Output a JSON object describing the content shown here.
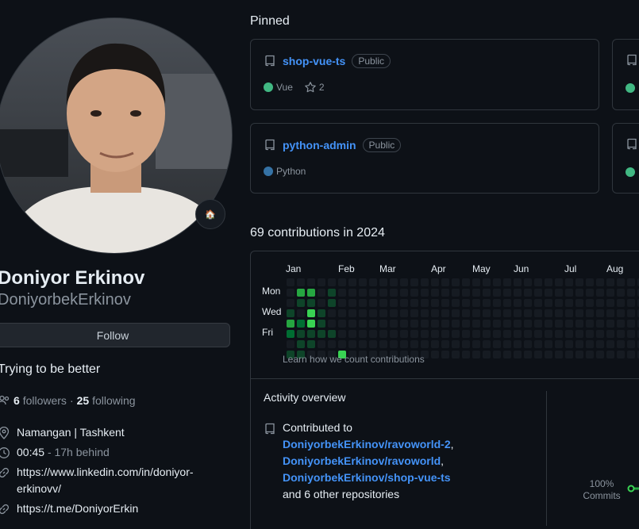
{
  "profile": {
    "full_name": "Doniyor Erkinov",
    "username": "DoniyorbekErkinov",
    "follow_label": "Follow",
    "bio": "Trying to be better",
    "followers_count": "6",
    "followers_label": "followers",
    "separator": "·",
    "following_count": "25",
    "following_label": "following",
    "status_emoji": "🏠",
    "details": [
      {
        "icon": "location-icon",
        "text": "Namangan | Tashkent"
      },
      {
        "icon": "clock-icon",
        "text": "00:45",
        "extra": "- 17h behind"
      },
      {
        "icon": "link-icon",
        "text": "https://www.linkedin.com/in/doniyor-erkinovv/"
      },
      {
        "icon": "link-icon",
        "text": "https://t.me/DoniyorErkin"
      }
    ]
  },
  "pinned": {
    "title": "Pinned",
    "repos": [
      {
        "name": "shop-vue-ts",
        "visibility": "Public",
        "language": "Vue",
        "language_color": "#41b883",
        "stars": "2"
      },
      {
        "name": "python-admin",
        "visibility": "Public",
        "language": "Python",
        "language_color": "#3572A5"
      }
    ]
  },
  "contributions": {
    "title": "69 contributions in 2024",
    "months": [
      "Jan",
      "Feb",
      "Mar",
      "Apr",
      "May",
      "Jun",
      "Jul",
      "Aug"
    ],
    "days": [
      "Mon",
      "Wed",
      "Fri"
    ],
    "learn_link": "Learn how we count contributions",
    "colors": {
      "empty": "#161b22",
      "l1": "#0e4429",
      "l2": "#006d32",
      "l3": "#26a641",
      "l4": "#39d353"
    },
    "active_cells": [
      {
        "week": 1,
        "day": 1,
        "level": 3
      },
      {
        "week": 2,
        "day": 1,
        "level": 3
      },
      {
        "week": 4,
        "day": 1,
        "level": 1
      },
      {
        "week": 1,
        "day": 2,
        "level": 1
      },
      {
        "week": 2,
        "day": 2,
        "level": 1
      },
      {
        "week": 4,
        "day": 2,
        "level": 1
      },
      {
        "week": 0,
        "day": 3,
        "level": 1
      },
      {
        "week": 2,
        "day": 3,
        "level": 4
      },
      {
        "week": 3,
        "day": 3,
        "level": 1
      },
      {
        "week": 0,
        "day": 4,
        "level": 3
      },
      {
        "week": 1,
        "day": 4,
        "level": 2
      },
      {
        "week": 2,
        "day": 4,
        "level": 4
      },
      {
        "week": 3,
        "day": 4,
        "level": 1
      },
      {
        "week": 0,
        "day": 5,
        "level": 2
      },
      {
        "week": 1,
        "day": 5,
        "level": 1
      },
      {
        "week": 2,
        "day": 5,
        "level": 1
      },
      {
        "week": 3,
        "day": 5,
        "level": 1
      },
      {
        "week": 4,
        "day": 5,
        "level": 1
      },
      {
        "week": 1,
        "day": 6,
        "level": 1
      },
      {
        "week": 2,
        "day": 6,
        "level": 1
      },
      {
        "week": 0,
        "day": 7,
        "level": 1
      },
      {
        "week": 1,
        "day": 7,
        "level": 1
      },
      {
        "week": 5,
        "day": 7,
        "level": 4
      }
    ]
  },
  "activity": {
    "title": "Activity overview",
    "contributed_label": "Contributed to",
    "repos": [
      "DoniyorbekErkinov/ravoworld-2",
      "DoniyorbekErkinov/ravoworld",
      "DoniyorbekErkinov/shop-vue-ts"
    ],
    "others": "and 6 other repositories",
    "percent": "100%",
    "percent_label": "Commits"
  }
}
